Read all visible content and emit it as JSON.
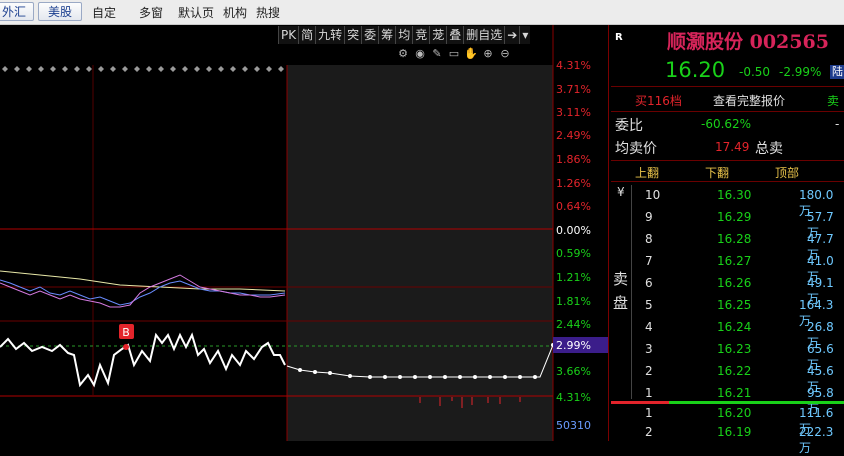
{
  "topbar": {
    "btn_forex": "外汇",
    "btn_us": "美股",
    "menu": [
      "自定",
      "多窗",
      "默认页",
      "机构",
      "热搜"
    ]
  },
  "toolbar": {
    "items": [
      "PK",
      "简",
      "九转",
      "突",
      "委",
      "筹",
      "均",
      "竞",
      "茏",
      "叠",
      "删自选"
    ]
  },
  "chart": {
    "pct_labels": [
      "4.31%",
      "3.71%",
      "3.11%",
      "2.49%",
      "1.86%",
      "1.26%",
      "0.64%",
      "0.00%",
      "0.59%",
      "1.21%",
      "1.81%",
      "2.44%",
      "2.99%",
      "3.66%",
      "4.31%"
    ],
    "current_pct": "2.99%",
    "b_marker": "B",
    "volume_label": "50310",
    "colors": {
      "up": "#e3242b",
      "down": "#19d119",
      "price_line": "#ffffff",
      "avg_line": "#e8e8a8"
    }
  },
  "quote": {
    "code_label": "R",
    "name": "顺灏股份 002565",
    "price": "16.20",
    "change": "-0.50",
    "change_pct": "-2.99%",
    "market_badge": "陆",
    "tabs": [
      "买116档",
      "查看完整报价",
      "卖"
    ],
    "ratio_label": "委比",
    "ratio_value": "-60.62%",
    "ratio_tail": "-",
    "avg_sell_label": "均卖价",
    "avg_sell_value": "17.49",
    "total_sell_label": "总卖",
    "col_headers": [
      "上翻",
      "下翻",
      "顶部"
    ],
    "yen": "¥",
    "sell_panel_label": "卖盘",
    "sell": [
      {
        "level": "10",
        "price": "16.30",
        "vol": "180.0万"
      },
      {
        "level": "9",
        "price": "16.29",
        "vol": "57.7万"
      },
      {
        "level": "8",
        "price": "16.28",
        "vol": "47.7万"
      },
      {
        "level": "7",
        "price": "16.27",
        "vol": "41.0万"
      },
      {
        "level": "6",
        "price": "16.26",
        "vol": "49.1万"
      },
      {
        "level": "5",
        "price": "16.25",
        "vol": "164.3万"
      },
      {
        "level": "4",
        "price": "16.24",
        "vol": "26.8万"
      },
      {
        "level": "3",
        "price": "16.23",
        "vol": "65.6万"
      },
      {
        "level": "2",
        "price": "16.22",
        "vol": "45.6万"
      },
      {
        "level": "1",
        "price": "16.21",
        "vol": "95.8万"
      }
    ],
    "buy": [
      {
        "level": "1",
        "price": "16.20",
        "vol": "111.6万"
      },
      {
        "level": "2",
        "price": "16.19",
        "vol": "222.3万"
      }
    ]
  }
}
